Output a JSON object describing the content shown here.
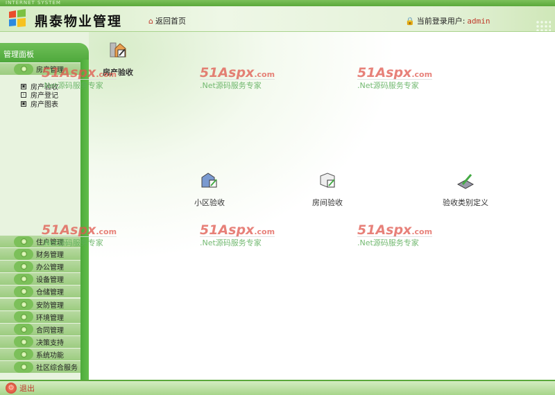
{
  "app": {
    "strip_text": "INTERNET SYSTEM",
    "title": "鼎泰物业管理",
    "home_link": "返回首页",
    "user_label": "当前登录用户:",
    "user_name": "admin"
  },
  "sidebar": {
    "panel_title": "管理面板",
    "active_group": "房产管理",
    "sub_items": [
      "房产验收",
      "房产登记",
      "房产图表"
    ],
    "groups": [
      "住户管理",
      "财务管理",
      "办公管理",
      "设备管理",
      "仓储管理",
      "安防管理",
      "环境管理",
      "合同管理",
      "决策支持",
      "系统功能",
      "社区综合服务"
    ]
  },
  "content": {
    "section_title": "房产验收",
    "tiles": [
      "小区验收",
      "房间验收",
      "验收类别定义"
    ]
  },
  "watermark": {
    "brand": "51Aspx",
    "domain": ".com",
    "slogan": ".Net源码服务专家"
  },
  "footer": {
    "logout": "退出"
  }
}
